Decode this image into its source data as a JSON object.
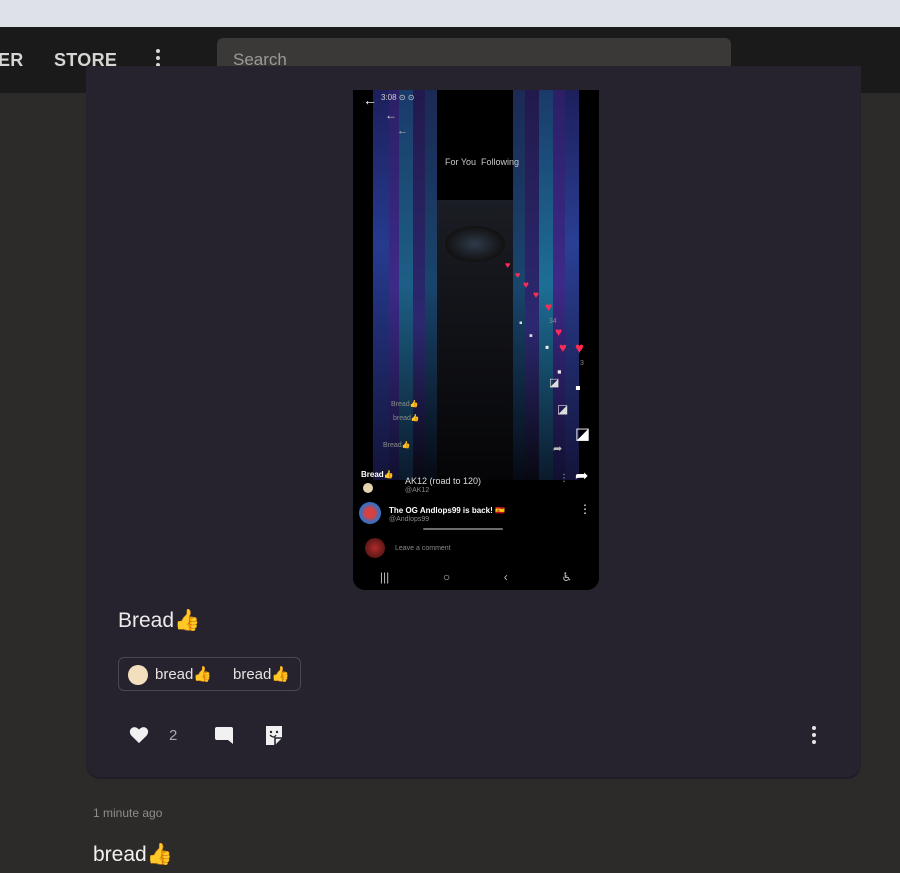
{
  "browser": {
    "chrome_color": "#dfe1e8"
  },
  "nav": {
    "items": [
      {
        "label": "ER"
      },
      {
        "label": "STORE"
      }
    ],
    "more_icon": "vertical-ellipsis-icon",
    "search_placeholder": "Search"
  },
  "post": {
    "screenshot": {
      "status": "3:08 ⊙ ⊙",
      "tabs": [
        "For You",
        "Following"
      ],
      "count_like": "3",
      "count_inner": "34",
      "comment_lines": [
        "Bread👍",
        "bread👍",
        "Bread👍",
        "Bread👍"
      ],
      "featured_name": "AK12 (road to 120)",
      "featured_sub": "@AK12",
      "user_name": "The OG Andlops99 is back! 🇪🇸",
      "user_handle": "@Andlops99",
      "comment_prompt": "Leave a comment",
      "nav_buttons": [
        "|||",
        "○",
        "‹",
        "♿"
      ]
    },
    "caption": "Bread👍",
    "stickers": [
      "bread👍",
      "bread👍"
    ],
    "actions": {
      "like_icon": "heart-icon",
      "like_count": "2",
      "comment_icon": "comment-icon",
      "sticker_icon": "sticker-icon",
      "more_icon": "vertical-ellipsis-icon"
    }
  },
  "next_post": {
    "timestamp": "1 minute ago",
    "title": "bread👍"
  },
  "colors": {
    "background": "#2c2b2a",
    "topbar": "#1a1a1a",
    "card": "#26232e",
    "heart": "#ff2d55"
  }
}
